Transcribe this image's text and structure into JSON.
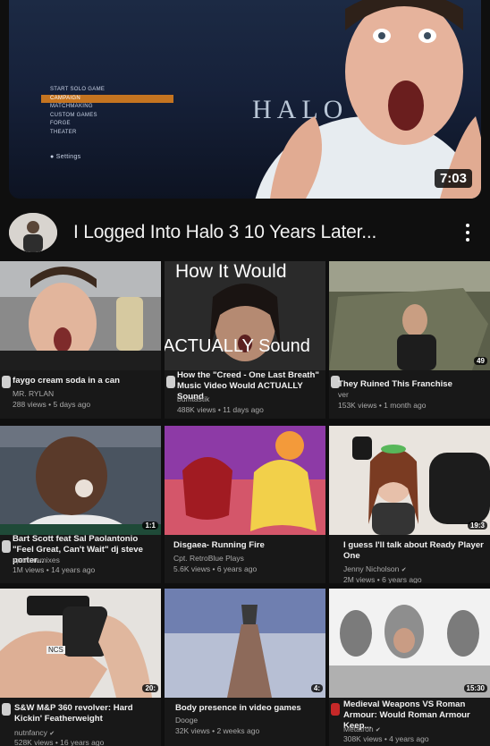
{
  "featured": {
    "menu_items": [
      "START SOLO GAME",
      "CAMPAIGN",
      "MATCHMAKING",
      "CUSTOM GAMES",
      "FORGE",
      "THEATER"
    ],
    "menu_settings": "Settings",
    "logo_text": "HALO",
    "duration": "7:03",
    "title": "I Logged Into Halo 3 10 Years Later..."
  },
  "videos": [
    {
      "title": "faygo cream soda in a can",
      "channel": "MR. RYLAN",
      "views": "288 views",
      "age": "5 days ago",
      "duration": "",
      "verified": false
    },
    {
      "title": "How the \"Creed - One Last Breath\" Music Video Would ACTUALLY Sound",
      "channel": "bumtastik",
      "views": "488K views",
      "age": "11 days ago",
      "duration": "",
      "verified": false,
      "thumb_top": "How It Would",
      "thumb_bottom": "ACTUALLY Sound"
    },
    {
      "title": "They Ruined This Franchise",
      "channel": "ver",
      "views": "153K views",
      "age": "1 month ago",
      "duration": "49",
      "verified": false
    },
    {
      "title": "Bart Scott feat Sal Paolantonio \"Feel Great, Can't Wait\" dj steve porter...",
      "channel": "sportsremixes",
      "views": "1M views",
      "age": "14 years ago",
      "duration": "1:1",
      "verified": false
    },
    {
      "title": "Disgaea- Running Fire",
      "channel": "Cpt. RetroBlue Plays",
      "views": "5.6K views",
      "age": "6 years ago",
      "duration": "",
      "verified": false
    },
    {
      "title": "I guess I'll talk about Ready Player One",
      "channel": "Jenny Nicholson",
      "views": "2M views",
      "age": "6 years ago",
      "duration": "19:3",
      "verified": true
    },
    {
      "title": "S&W M&P 360 revolver: Hard Kickin' Featherweight",
      "channel": "nutnfancy",
      "views": "528K views",
      "age": "16 years ago",
      "duration": "20:",
      "verified": true,
      "thumb_text": "NCS"
    },
    {
      "title": "Body presence in video games",
      "channel": "Dooge",
      "views": "32K views",
      "age": "2 weeks ago",
      "duration": "4:",
      "verified": false
    },
    {
      "title": "Medieval Weapons VS Roman Armour: Would Roman Armour Keep...",
      "channel": "Metatron",
      "views": "308K views",
      "age": "4 years ago",
      "duration": "15:30",
      "verified": true
    }
  ],
  "colors": {
    "background": "#0f0f0f",
    "card": "#181818",
    "text_primary": "#f1f1f1",
    "text_secondary": "#aaaaaa",
    "duration_bg": "#000000"
  }
}
